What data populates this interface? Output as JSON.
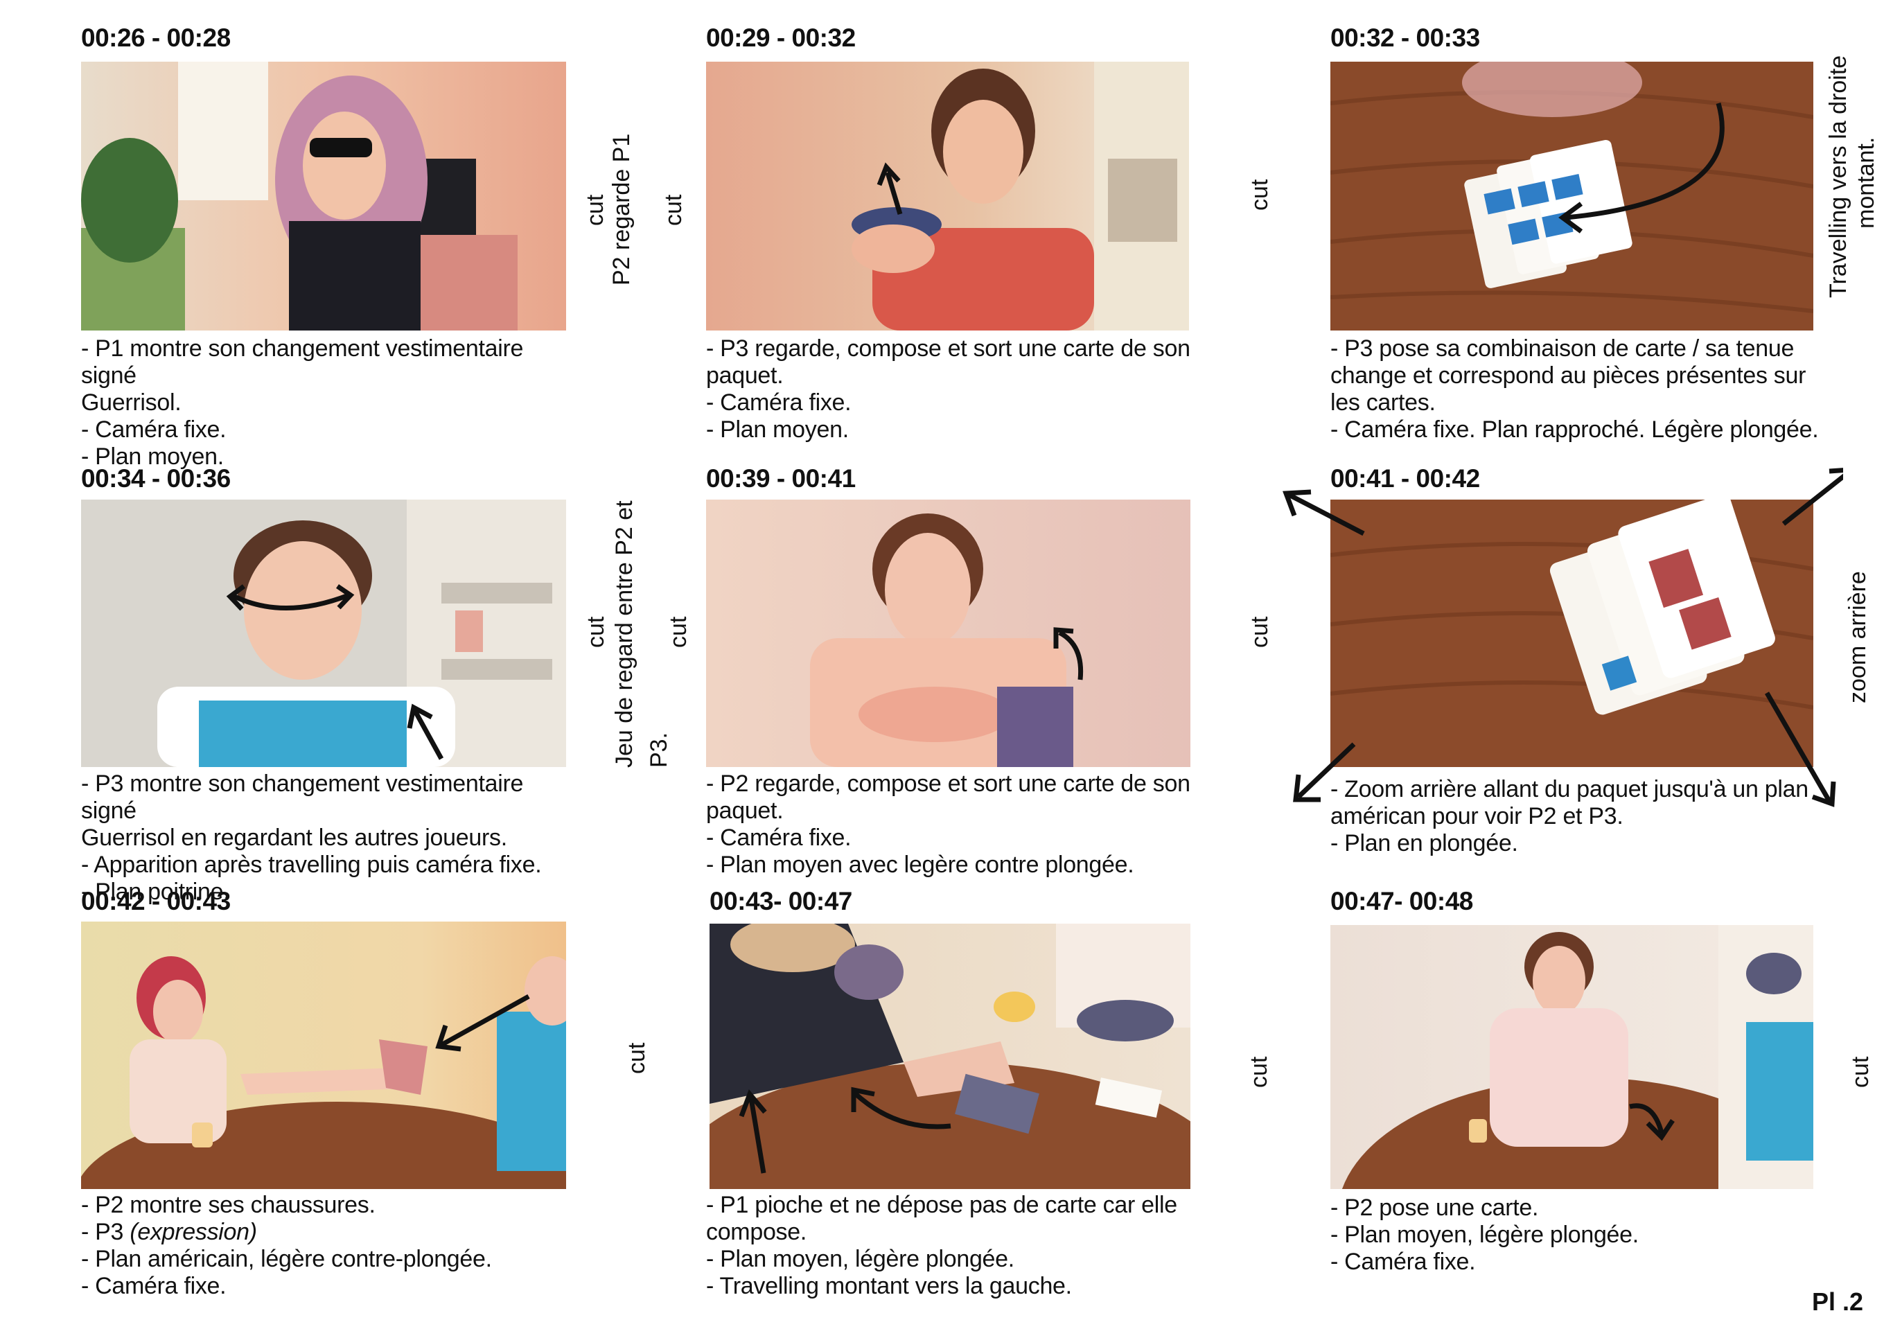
{
  "page_number": "Pl .2",
  "shots": [
    {
      "time": "00:26 - 00:28",
      "lines": [
        "- P1 montre son changement vestimentaire signé",
        "Guerrisol.",
        "- Caméra fixe.",
        "- Plan moyen."
      ],
      "image": "Woman with pink hair adjusting sunglasses in a living room"
    },
    {
      "time": "00:29 - 00:32",
      "lines": [
        "- P3 regarde, compose et sort une carte de son",
        "paquet.",
        "- Caméra fixe.",
        "- Plan moyen."
      ],
      "image": "Young man in red polo holding playing cards"
    },
    {
      "time": "00:32 - 00:33",
      "lines": [
        "- P3 pose sa combinaison de carte / sa tenue",
        "change et correspond au pièces présentes sur",
        "les cartes.",
        "- Caméra fixe. Plan rapproché. Légère plongée."
      ],
      "image": "Playing cards placed on a wooden table"
    },
    {
      "time": "00:34 - 00:36",
      "lines": [
        "- P3 montre son changement vestimentaire signé",
        "Guerrisol en regardant les autres joueurs.",
        "- Apparition après travelling puis caméra fixe.",
        "- Plan poitrine."
      ],
      "image": "Young man in blue vest looking sideways"
    },
    {
      "time": "00:39 - 00:41",
      "lines": [
        "- P2 regarde, compose et sort une carte de son",
        "paquet.",
        "- Caméra fixe.",
        "- Plan moyen avec legère contre plongée."
      ],
      "image": "Woman with glasses drawing a card from her hand"
    },
    {
      "time": "00:41 - 00:42",
      "lines": [
        "- Zoom arrière allant du paquet jusqu'à un plan",
        "américan pour voir P2 et P3.",
        "- Plan en plongée."
      ],
      "image": "Close-up of playing cards on a wooden table"
    },
    {
      "time": "00:42 - 00:43",
      "lines_pre": [
        "- P2 montre ses chaussures."
      ],
      "line_p3": "- P3 ",
      "line_p3_em": "(expression)",
      "lines_post": [
        "- Plan américain, légère contre-plongée.",
        "- Caméra fixe."
      ],
      "image": "Players at table, one showing her shoes"
    },
    {
      "time": "00:43- 00:47",
      "lines": [
        "- P1 pioche et ne dépose pas de carte car elle",
        "compose.",
        "- Plan moyen, légère plongée.",
        "- Travelling montant vers la gauche."
      ],
      "image": "Hand placing a card on the table with a candle"
    },
    {
      "time": "00:47- 00:48",
      "lines": [
        "- P2 pose une carte.",
        "- Plan moyen, légère plongée.",
        "- Caméra fixe."
      ],
      "image": "Woman putting down a card at the table"
    }
  ],
  "side_notes": {
    "r1_a_cut": "cut",
    "r1_a_note": "P2 regarde P1",
    "r1_a_cut2": "cut",
    "r1_b_cut": "cut",
    "r1_c_note1": "Travelling vers la droite",
    "r1_c_note2": "montant.",
    "r2_a_cut": "cut",
    "r2_a_note1": "Jeu de regard entre P2 et",
    "r2_a_note2": "P3.",
    "r2_a_cut2": "cut",
    "r2_b_cut": "cut",
    "r2_c_note": "zoom arrière",
    "r3_a_cut": "cut",
    "r3_b_cut": "cut",
    "r3_c_cut": "cut"
  },
  "colors": {
    "warm_wall": "#f2c9a8",
    "table_wood": "#8a4a2a",
    "pink_hair": "#c48aa8",
    "red_shirt": "#d9584a",
    "blue_vest": "#3aa8d0"
  }
}
